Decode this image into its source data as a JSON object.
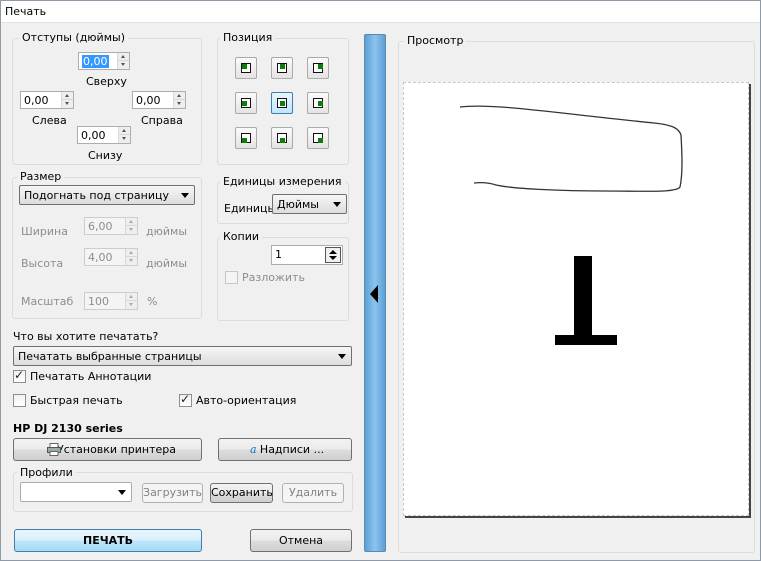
{
  "window": {
    "title": "Печать"
  },
  "margins": {
    "title": "Отступы (дюймы)",
    "top": {
      "label": "Сверху",
      "value": "0,00"
    },
    "left": {
      "label": "Слева",
      "value": "0,00"
    },
    "right": {
      "label": "Справа",
      "value": "0,00"
    },
    "bottom": {
      "label": "Снизу",
      "value": "0,00"
    }
  },
  "position": {
    "title": "Позиция",
    "selected": "center"
  },
  "size": {
    "title": "Размер",
    "mode": "Подогнать под страницу",
    "width": {
      "label": "Ширина",
      "value": "6,00",
      "unit": "дюймы"
    },
    "height": {
      "label": "Высота",
      "value": "4,00",
      "unit": "дюймы"
    },
    "scale": {
      "label": "Масштаб",
      "value": "100",
      "unit": "%"
    }
  },
  "units": {
    "title": "Единицы измерения",
    "label": "Единицы",
    "value": "Дюймы"
  },
  "copies": {
    "title": "Копии",
    "value": "1",
    "collate_label": "Разложить",
    "collate_checked": false
  },
  "what_to_print": {
    "label": "Что вы хотите печатать?",
    "value": "Печатать выбранные страницы"
  },
  "options": {
    "print_annotations": {
      "label": "Печатать Аннотации",
      "checked": true
    },
    "quick_print": {
      "label": "Быстрая печать",
      "checked": false
    },
    "auto_orientation": {
      "label": "Авто-ориентация",
      "checked": true
    }
  },
  "printer": {
    "name": "HP DJ 2130 series",
    "settings_button": "Установки принтера",
    "captions_button": "Надписи ..."
  },
  "profiles": {
    "title": "Профили",
    "value": "",
    "load_button": "Загрузить",
    "save_button": "Сохранить",
    "delete_button": "Удалить"
  },
  "actions": {
    "print_button": "ПЕЧАТЬ",
    "cancel_button": "Отмена"
  },
  "preview": {
    "title": "Просмотр"
  }
}
